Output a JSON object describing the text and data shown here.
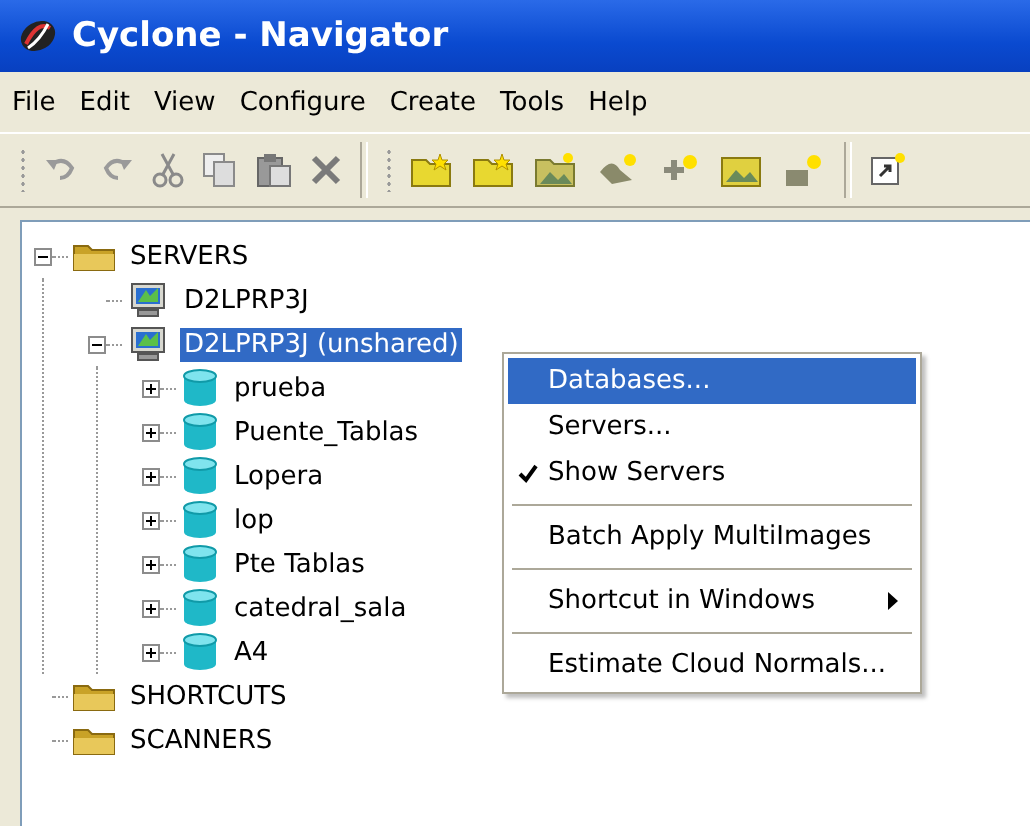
{
  "window": {
    "title": "Cyclone - Navigator"
  },
  "menu_bar": [
    "File",
    "Edit",
    "View",
    "Configure",
    "Create",
    "Tools",
    "Help"
  ],
  "tree": [
    {
      "label": "SERVERS",
      "kind": "folder",
      "expanded": true,
      "selected": false,
      "children": [
        {
          "label": "D2LPRP3J",
          "kind": "computer",
          "selected": false
        },
        {
          "label": "D2LPRP3J (unshared)",
          "kind": "computer",
          "expanded": true,
          "selected": true,
          "children": [
            {
              "label": "prueba",
              "kind": "database",
              "expanded": false,
              "selected": false
            },
            {
              "label": "Puente_Tablas",
              "kind": "database",
              "expanded": false,
              "selected": false
            },
            {
              "label": "Lopera",
              "kind": "database",
              "expanded": false,
              "selected": false
            },
            {
              "label": "lop",
              "kind": "database",
              "expanded": false,
              "selected": false
            },
            {
              "label": "Pte Tablas",
              "kind": "database",
              "expanded": false,
              "selected": false
            },
            {
              "label": "catedral_sala",
              "kind": "database",
              "expanded": false,
              "selected": false
            },
            {
              "label": "A4",
              "kind": "database",
              "expanded": false,
              "selected": false
            }
          ]
        }
      ]
    },
    {
      "label": "SHORTCUTS",
      "kind": "folder",
      "selected": false
    },
    {
      "label": "SCANNERS",
      "kind": "folder",
      "selected": false
    }
  ],
  "context_menu": [
    {
      "kind": "item",
      "label": "Databases...",
      "selected": true,
      "checked": false
    },
    {
      "kind": "item",
      "label": "Servers...",
      "selected": false,
      "checked": false
    },
    {
      "kind": "item",
      "label": "Show Servers",
      "selected": false,
      "checked": true
    },
    {
      "kind": "separator"
    },
    {
      "kind": "item",
      "label": "Batch Apply MultiImages",
      "selected": false,
      "checked": false
    },
    {
      "kind": "separator"
    },
    {
      "kind": "item",
      "label": "Shortcut in Windows",
      "selected": false,
      "checked": false,
      "submenu": true
    },
    {
      "kind": "separator"
    },
    {
      "kind": "item",
      "label": "Estimate Cloud Normals...",
      "selected": false,
      "checked": false
    }
  ]
}
